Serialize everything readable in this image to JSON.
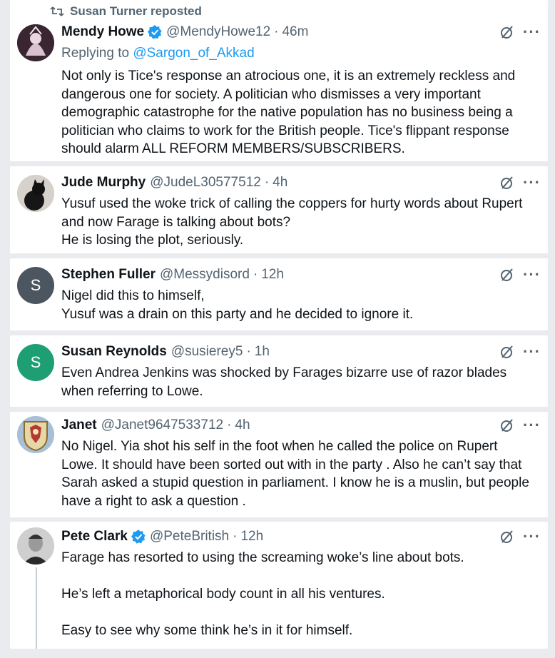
{
  "repost_banner": {
    "icon": "repost-icon",
    "text": "Susan Turner reposted"
  },
  "colors": {
    "accent": "#1d9bf0",
    "muted": "#536471",
    "avatar_s": "#4b5660",
    "avatar_s2": "#1e9e73"
  },
  "posts": [
    {
      "name": "Mendy Howe",
      "handle": "@MendyHowe12",
      "time": "46m",
      "verified": true,
      "reply_prefix": "Replying to ",
      "reply_to": "@Sargon_of_Akkad",
      "text": "Not only is Tice's response an atrocious one, it is an extremely reckless and dangerous one for society. A politician who dismisses a very important demographic catastrophe for the native population has no business being a politician who claims to work for the British people. Tice's flippant response should alarm ALL REFORM MEMBERS/SUBSCRIBERS."
    },
    {
      "name": "Jude Murphy",
      "handle": "@JudeL30577512",
      "time": "4h",
      "text": "Yusuf used the woke trick of calling the coppers for hurty words about Rupert and now Farage is talking about bots?\nHe is losing the plot, seriously."
    },
    {
      "name": "Stephen Fuller",
      "handle": "@Messydisord",
      "time": "12h",
      "avatar_letter": "S",
      "text": "Nigel did this to himself,\nYusuf was a drain on this party and he decided to ignore it."
    },
    {
      "name": "Susan Reynolds",
      "handle": "@susierey5",
      "time": "1h",
      "avatar_letter": "S",
      "text": "Even Andrea Jenkins was shocked by Farages bizarre use of razor blades when referring to Lowe."
    },
    {
      "name": "Janet",
      "handle": "@Janet9647533712",
      "time": "4h",
      "text": "No Nigel. Yia shot his self in the foot when he called the police on Rupert Lowe. It should have been sorted out with in the party . Also he can’t say that Sarah asked a stupid question in parliament. I know he is a muslin, but people have a right to ask a question ."
    },
    {
      "name": "Pete Clark",
      "handle": "@PeteBritish",
      "time": "12h",
      "verified": true,
      "text": "Farage has resorted to using the screaming woke’s line about bots.\n\nHe’s left a metaphorical body count in all his ventures.\n\nEasy to see why some think he’s in it for himself."
    }
  ],
  "dot": "·",
  "more_label": "···"
}
